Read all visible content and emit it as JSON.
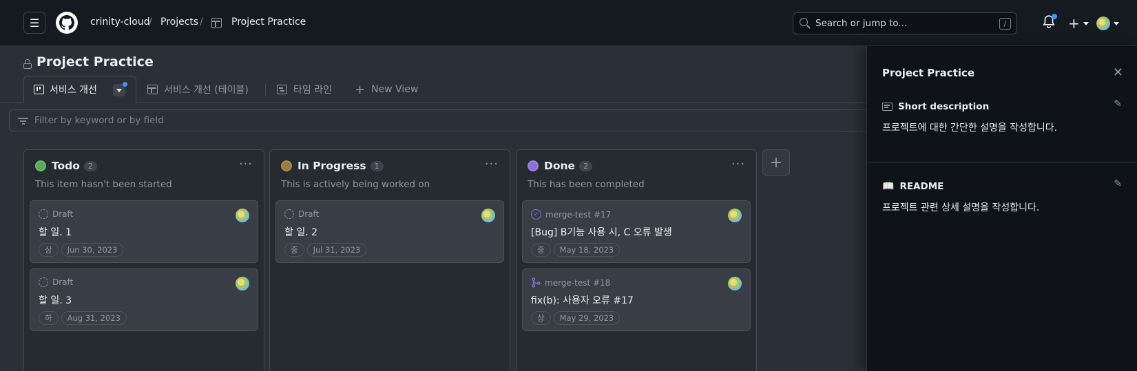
{
  "header": {
    "org": "crinity-cloud",
    "projects": "Projects",
    "project": "Project Practice",
    "search_placeholder": "Search or jump to...",
    "search_key": "/",
    "plus": "+"
  },
  "page": {
    "title": "Project Practice",
    "tabs": [
      {
        "label": "서비스 개선"
      },
      {
        "label": "서비스 개선 (테이블)"
      },
      {
        "label": "타임 라인"
      },
      {
        "label": "New View"
      }
    ],
    "filter_placeholder": "Filter by keyword or by field"
  },
  "columns": [
    {
      "title": "Todo",
      "count": "2",
      "desc": "This item hasn't been started",
      "color": "#57ab5a",
      "cards": [
        {
          "kind": "Draft",
          "title": "할 일. 1",
          "labels": [
            "상",
            "Jun 30, 2023"
          ]
        },
        {
          "kind": "Draft",
          "title": "할 일. 3",
          "labels": [
            "하",
            "Aug 31, 2023"
          ]
        }
      ]
    },
    {
      "title": "In Progress",
      "count": "1",
      "desc": "This is actively being worked on",
      "color": "#9c7b3d",
      "cards": [
        {
          "kind": "Draft",
          "title": "할 일. 2",
          "labels": [
            "중",
            "Jul 31, 2023"
          ]
        }
      ]
    },
    {
      "title": "Done",
      "count": "2",
      "desc": "This has been completed",
      "color": "#8a6fd6",
      "cards": [
        {
          "kind": "merge-test #17",
          "title": "[Bug] B기능 사용 시, C 오류 발생",
          "labels": [
            "중",
            "May 18, 2023"
          ]
        },
        {
          "kind": "merge-test #18",
          "title": "fix(b): 사용자 오류 #17",
          "labels": [
            "상",
            "May 29, 2023"
          ]
        }
      ]
    }
  ],
  "panel": {
    "title": "Project Practice",
    "short_desc_label": "Short description",
    "short_desc_text": "프로젝트에 대한 간단한 설명을 작성합니다.",
    "readme_label": "README",
    "readme_text": "프로젝트 관련 상세 설명을 작성합니다."
  },
  "icons": {
    "menu": "hamburger-icon",
    "logo": "github-logo-icon",
    "bell": "bell-icon",
    "lock": "lock-icon",
    "filter": "filter-icon",
    "close": "close-icon",
    "edit": "pencil-icon"
  }
}
